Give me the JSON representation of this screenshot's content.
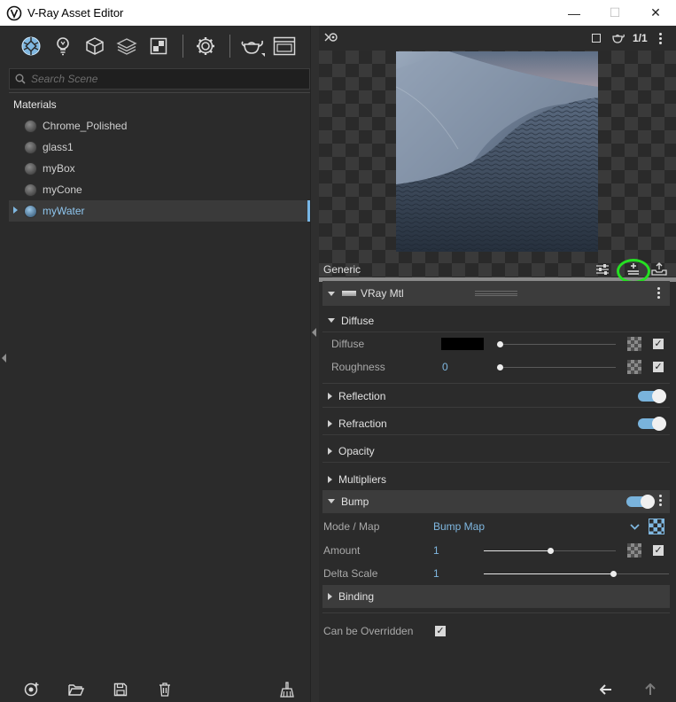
{
  "window": {
    "title": "V-Ray Asset Editor",
    "minimize": "—",
    "maximize": "☐",
    "close": "✕"
  },
  "left_toolbar": {
    "icons": [
      "materials-icon",
      "lights-icon",
      "geometry-icon",
      "render-elements-icon",
      "textures-icon",
      "settings-icon",
      "render-icon",
      "frame-buffer-icon"
    ]
  },
  "search": {
    "placeholder": "Search Scene",
    "value": ""
  },
  "tree": {
    "header": "Materials",
    "items": [
      {
        "label": "Chrome_Polished"
      },
      {
        "label": "glass1"
      },
      {
        "label": "myBox"
      },
      {
        "label": "myCone"
      },
      {
        "label": "myWater"
      }
    ],
    "selected_index": 4
  },
  "preview_toolbar": {
    "render_counter": "1/1"
  },
  "generic": {
    "label": "Generic"
  },
  "material": {
    "name": "VRay Mtl"
  },
  "diffuse_section": {
    "title": "Diffuse",
    "diffuse_label": "Diffuse",
    "diffuse_color": "#000000",
    "roughness_label": "Roughness",
    "roughness_value": "0",
    "roughness_fraction": 0.0
  },
  "sections": {
    "reflection": "Reflection",
    "refraction": "Refraction",
    "opacity": "Opacity",
    "multipliers": "Multipliers",
    "bump": "Bump",
    "binding": "Binding"
  },
  "bump": {
    "mode_label": "Mode / Map",
    "mode_value": "Bump Map",
    "amount_label": "Amount",
    "amount_value": "1",
    "amount_fraction": 0.5,
    "delta_label": "Delta Scale",
    "delta_value": "1",
    "delta_fraction": 0.7
  },
  "override": {
    "label": "Can be Overridden",
    "checked": true
  },
  "colors": {
    "accent": "#7fb7e0",
    "highlight_ring": "#25e022",
    "panel_bg": "#2b2b2b"
  }
}
